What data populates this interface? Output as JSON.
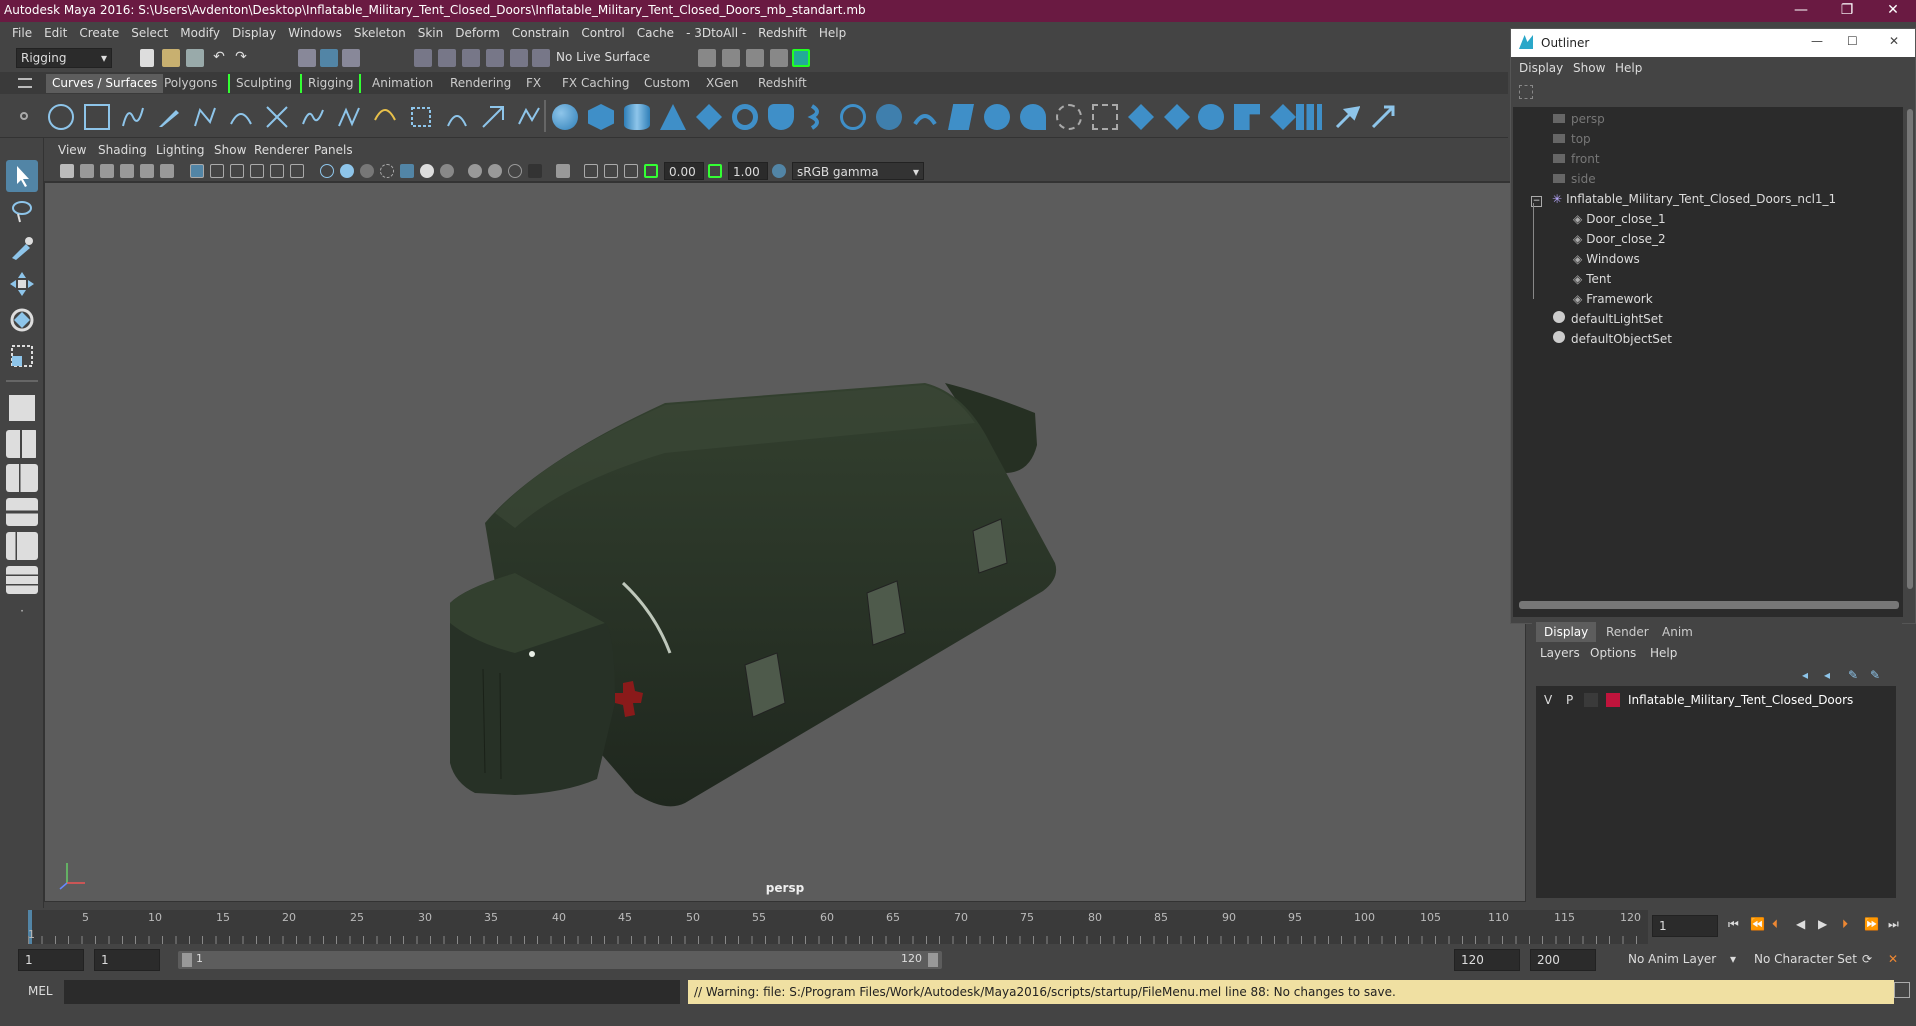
{
  "title_bar": {
    "title": "Autodesk Maya 2016: S:\\Users\\Avdenton\\Desktop\\Inflatable_Military_Tent_Closed_Doors\\Inflatable_Military_Tent_Closed_Doors_mb_standart.mb",
    "minimize": "—",
    "restore": "❐",
    "close": "✕"
  },
  "menubar": {
    "items": [
      "File",
      "Edit",
      "Create",
      "Select",
      "Modify",
      "Display",
      "Windows",
      "Skeleton",
      "Skin",
      "Deform",
      "Constrain",
      "Control",
      "Cache",
      "- 3DtoAll -",
      "Redshift",
      "Help"
    ]
  },
  "status_line": {
    "menu_set": "Rigging",
    "live_surface": "No Live Surface"
  },
  "shelf_tabs": [
    "Curves / Surfaces",
    "Polygons",
    "Sculpting",
    "Rigging",
    "Animation",
    "Rendering",
    "FX",
    "FX Caching",
    "Custom",
    "XGen",
    "Redshift"
  ],
  "viewport": {
    "menus": [
      "View",
      "Shading",
      "Lighting",
      "Show",
      "Renderer",
      "Panels"
    ],
    "near_value": "0.00",
    "far_value": "1.00",
    "color_space": "sRGB gamma",
    "camera_label": "persp"
  },
  "outliner": {
    "title": "Outliner",
    "menus": [
      "Display",
      "Show",
      "Help"
    ],
    "items": [
      {
        "label": "persp",
        "type": "camera"
      },
      {
        "label": "top",
        "type": "camera"
      },
      {
        "label": "front",
        "type": "camera"
      },
      {
        "label": "side",
        "type": "camera"
      },
      {
        "label": "Inflatable_Military_Tent_Closed_Doors_ncl1_1",
        "type": "group"
      },
      {
        "label": "Door_close_1",
        "type": "mesh"
      },
      {
        "label": "Door_close_2",
        "type": "mesh"
      },
      {
        "label": "Windows",
        "type": "mesh"
      },
      {
        "label": "Tent",
        "type": "mesh"
      },
      {
        "label": "Framework",
        "type": "mesh"
      },
      {
        "label": "defaultLightSet",
        "type": "set"
      },
      {
        "label": "defaultObjectSet",
        "type": "set"
      }
    ]
  },
  "layer_editor": {
    "tabs": [
      "Display",
      "Render",
      "Anim"
    ],
    "menus": [
      "Layers",
      "Options",
      "Help"
    ],
    "layer": {
      "v": "V",
      "p": "P",
      "name": "Inflatable_Military_Tent_Closed_Doors",
      "color": "#c0143c"
    }
  },
  "timeline": {
    "ticks": [
      "1",
      "5",
      "10",
      "15",
      "20",
      "25",
      "30",
      "35",
      "40",
      "45",
      "50",
      "55",
      "60",
      "65",
      "70",
      "75",
      "80",
      "85",
      "90",
      "95",
      "100",
      "105",
      "110",
      "115",
      "120"
    ],
    "current_frame": "1"
  },
  "range": {
    "start": "1",
    "playback_start": "1",
    "slider_start": "1",
    "slider_end": "120",
    "playback_end": "120",
    "end": "200",
    "anim_layer": "No Anim Layer",
    "character_set": "No Character Set"
  },
  "command_line": {
    "mode": "MEL",
    "warning": "// Warning: file: S:/Program Files/Work/Autodesk/Maya2016/scripts/startup/FileMenu.mel line 88: No changes to save."
  },
  "colors": {
    "title_bar": "#6a1a42",
    "accent": "#5285a6",
    "tent": "#2a3328",
    "warning_bg": "#f0e0a2"
  }
}
